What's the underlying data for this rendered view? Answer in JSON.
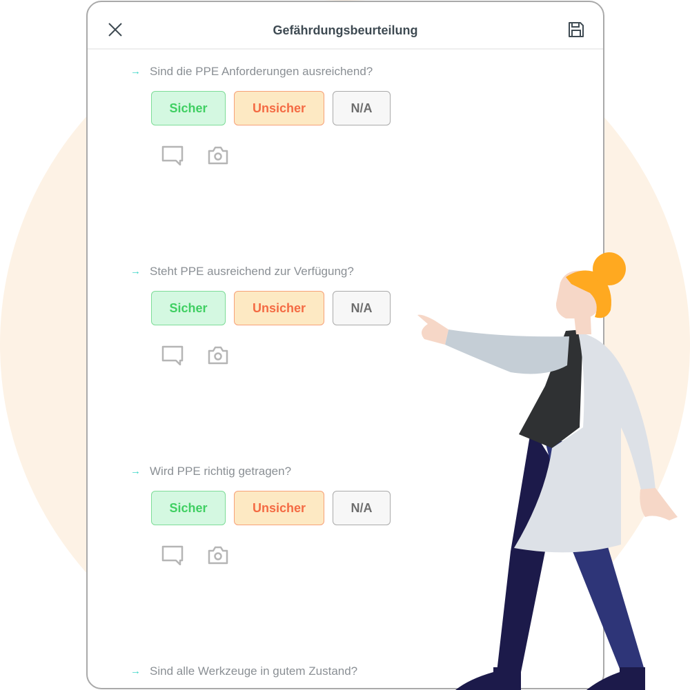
{
  "header": {
    "title": "Gefährdungsbeurteilung",
    "close_icon": "close-icon",
    "save_icon": "save-icon"
  },
  "options": {
    "safe": "Sicher",
    "unsafe": "Unsicher",
    "na": "N/A"
  },
  "questions": [
    {
      "text": "Sind die PPE Anforderungen ausreichend?"
    },
    {
      "text": "Steht PPE ausreichend zur Verfügung?"
    },
    {
      "text": "Wird PPE richtig getragen?"
    },
    {
      "text": "Sind alle Werkzeuge in gutem Zustand?"
    }
  ],
  "colors": {
    "accent_arrow": "#3fd6c8",
    "safe_bg": "#d4f8e1",
    "safe_border": "#7ddc97",
    "safe_text": "#3fcf62",
    "unsafe_bg": "#fde9c3",
    "unsafe_border": "#f7a077",
    "unsafe_text": "#f46a43",
    "na_bg": "#f7f7f7",
    "na_border": "#a9a9a9",
    "na_text": "#6e6e6e",
    "background_circle": "#fdf2e5"
  }
}
